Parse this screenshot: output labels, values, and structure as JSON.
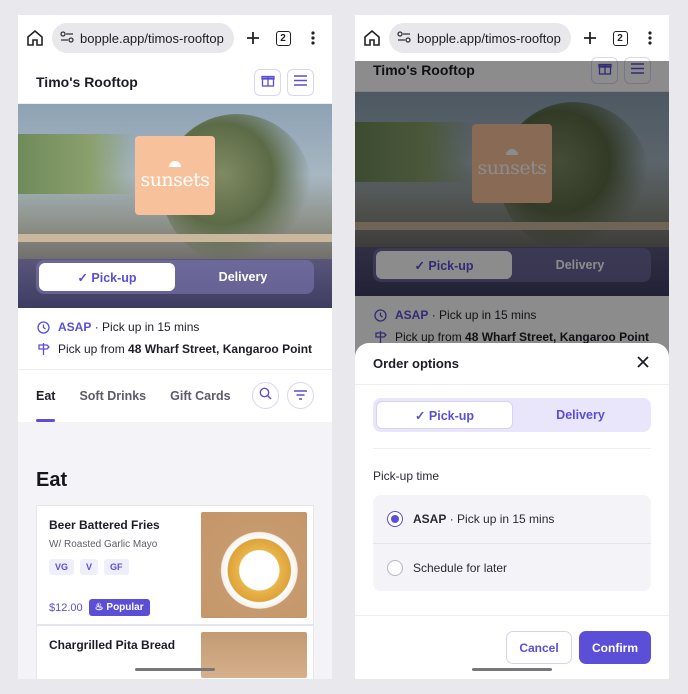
{
  "browser": {
    "url": "bopple.app/timos-rooftop",
    "tab_count": "2"
  },
  "header": {
    "title": "Timo's Rooftop"
  },
  "hero": {
    "logo_text": "sunsets"
  },
  "order_mode": {
    "pickup_label": "✓ Pick-up",
    "delivery_label": "Delivery"
  },
  "info": {
    "asap": "ASAP",
    "asap_detail": "· Pick up in 15 mins",
    "pickup_prefix": "Pick up from ",
    "pickup_address": "48 Wharf Street, Kangaroo Point"
  },
  "tabs": [
    "Eat",
    "Soft Drinks",
    "Gift Cards"
  ],
  "menu": {
    "section": "Eat",
    "items": [
      {
        "title": "Beer Battered Fries",
        "subtitle": "W/ Roasted Garlic Mayo",
        "tags": [
          "VG",
          "V",
          "GF"
        ],
        "price": "$12.00",
        "badge": "Popular"
      },
      {
        "title": "Chargrilled Pita Bread"
      }
    ]
  },
  "sheet": {
    "title": "Order options",
    "pickup_label": "✓ Pick-up",
    "delivery_label": "Delivery",
    "time_label": "Pick-up time",
    "opt_asap": "ASAP",
    "opt_asap_detail": "· Pick up in 15 mins",
    "opt_later": "Schedule for later",
    "cancel": "Cancel",
    "confirm": "Confirm"
  },
  "colors": {
    "accent": "#5a4fd6",
    "logo_bg": "#f7c19c"
  }
}
